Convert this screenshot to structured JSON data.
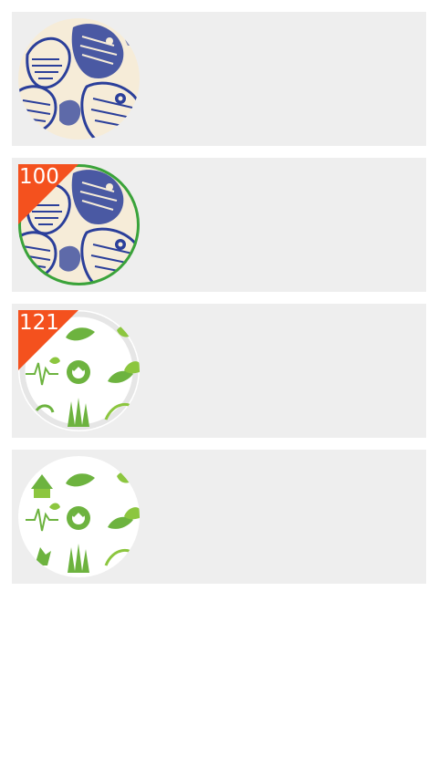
{
  "colors": {
    "card_background": "#eeeeee",
    "badge_background": "#f4511e",
    "badge_text": "#ffffff",
    "selected_ring": "#3aa33a",
    "birds_ink": "#2b3f9a",
    "birds_paper": "#f6ecd8",
    "leaf_green": "#6db33f"
  },
  "list": {
    "items": [
      {
        "image": "blue-birds-pattern-thumbnail",
        "badge": null,
        "selected": false
      },
      {
        "image": "blue-birds-pattern-thumbnail",
        "badge": "100",
        "selected": true
      },
      {
        "image": "green-eco-icons-thumbnail",
        "badge": "121",
        "selected": false
      },
      {
        "image": "green-eco-icons-thumbnail",
        "badge": null,
        "selected": false
      }
    ]
  }
}
